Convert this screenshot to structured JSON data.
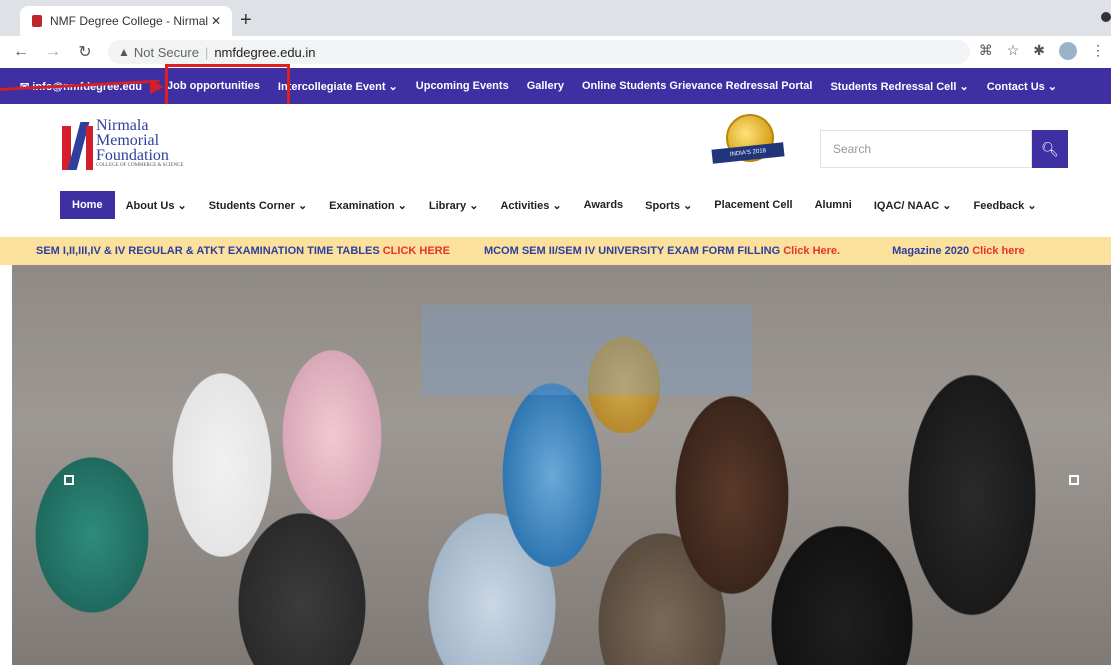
{
  "browser": {
    "tab_title": "NMF Degree College - Nirmala",
    "tab_close": "✕",
    "new_tab": "+",
    "not_secure_label": "Not Secure",
    "url": "nmfdegree.edu.in"
  },
  "topnav": {
    "email": "info@nmfdegree.edu",
    "items": [
      "Job opportunities",
      "Intercollegiate Event ⌄",
      "Upcoming Events",
      "Gallery",
      "Online Students Grievance Redressal Portal",
      "Students Redressal Cell ⌄",
      "Contact Us ⌄"
    ]
  },
  "header": {
    "logo_lines": [
      "Nirmala",
      "Memorial",
      "Foundation"
    ],
    "logo_small": "COLLEGE OF COMMERCE & SCIENCE",
    "badge_text": "INDIA'S 2018",
    "search_placeholder": "Search"
  },
  "mainnav": {
    "items": [
      "Home",
      "About Us ⌄",
      "Students Corner ⌄",
      "Examination ⌄",
      "Library ⌄",
      "Activities ⌄",
      "Awards",
      "Sports ⌄",
      "Placement Cell",
      "Alumni",
      "IQAC/ NAAC ⌄",
      "Feedback ⌄"
    ]
  },
  "ticker": {
    "item1_text": "SEM I,II,III,IV & IV REGULAR & ATKT EXAMINATION TIME TABLES ",
    "item1_link": "CLICK HERE",
    "item2_text": "MCOM SEM II/SEM IV UNIVERSITY EXAM FORM FILLING ",
    "item2_link": "Click Here.",
    "item3_text": "Magazine 2020 ",
    "item3_link": "Click here"
  },
  "colors": {
    "brand_purple": "#3e2fa3",
    "ticker_bg": "#fbe19b",
    "highlight_red": "#e02020"
  }
}
